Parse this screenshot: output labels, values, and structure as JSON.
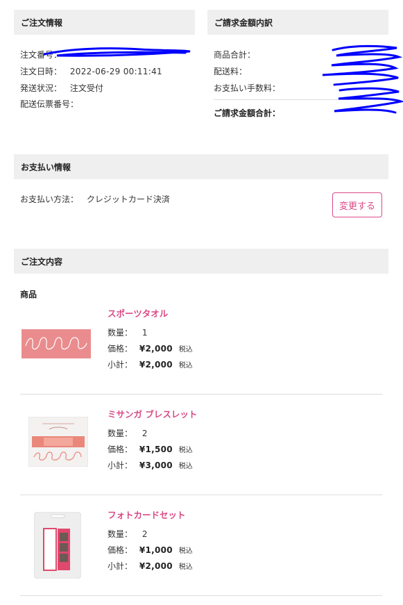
{
  "order_info": {
    "title": "ご注文情報",
    "order_number_label": "注文番号：",
    "order_date_label": "注文日時：",
    "order_date_value": "2022-06-29 00:11:41",
    "status_label": "発送状況：",
    "status_value": "注文受付",
    "tracking_label": "配送伝票番号："
  },
  "billing": {
    "title": "ご請求金額内訳",
    "subtotal_label": "商品合計：",
    "shipping_label": "配送料：",
    "fee_label": "お支払い手数料：",
    "total_label": "ご請求金額合計："
  },
  "payment": {
    "title": "お支払い情報",
    "method_label": "お支払い方法：",
    "method_value": "クレジットカード決済",
    "change_button": "変更する"
  },
  "contents": {
    "title": "ご注文内容",
    "products_heading": "商品",
    "qty_label": "数量：",
    "price_label": "価格：",
    "subtotal_label": "小計：",
    "tax_label": "税込",
    "items": [
      {
        "name": "スポーツタオル",
        "qty": "1",
        "price": "¥2,000",
        "subtotal": "¥2,000"
      },
      {
        "name": "ミサンガ ブレスレット",
        "qty": "2",
        "price": "¥1,500",
        "subtotal": "¥3,000"
      },
      {
        "name": "フォトカードセット",
        "qty": "2",
        "price": "¥1,000",
        "subtotal": "¥2,000"
      }
    ]
  },
  "colors": {
    "accent": "#d94a86",
    "header_bg": "#efefef",
    "scribble": "#0000ff"
  }
}
